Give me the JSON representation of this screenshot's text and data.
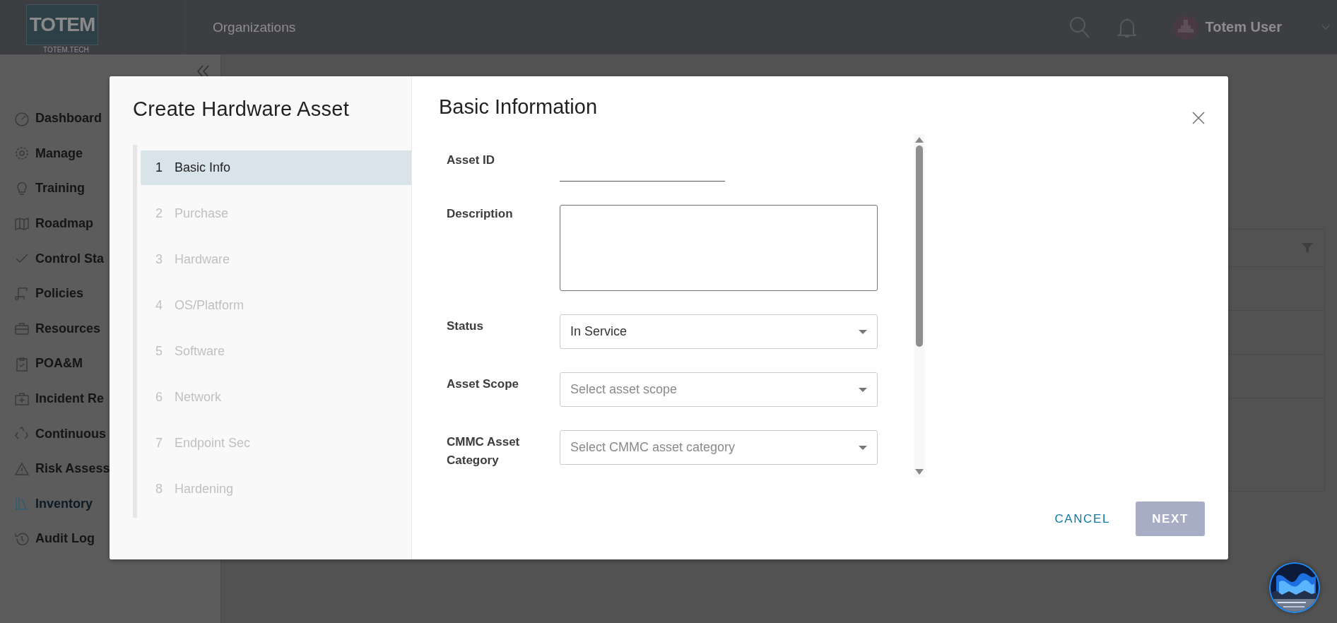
{
  "header": {
    "logo_text": "TOTEM",
    "logo_caption": "TOTEM.TECH",
    "nav_item": "Organizations",
    "user_name": "Totem User"
  },
  "sidebar": {
    "items": [
      {
        "label": "Dashboard",
        "selected": false
      },
      {
        "label": "Manage",
        "selected": false
      },
      {
        "label": "Training",
        "selected": false
      },
      {
        "label": "Roadmap",
        "selected": false
      },
      {
        "label": "Control Sta",
        "selected": false
      },
      {
        "label": "Policies",
        "selected": false
      },
      {
        "label": "Resources",
        "selected": false
      },
      {
        "label": "POA&M",
        "selected": false
      },
      {
        "label": "Incident Re",
        "selected": false
      },
      {
        "label": "Continuous",
        "selected": false
      },
      {
        "label": "Risk Assess",
        "selected": false
      },
      {
        "label": "Inventory",
        "selected": true
      },
      {
        "label": "Audit Log",
        "selected": false
      }
    ]
  },
  "modal": {
    "title": "Create Hardware Asset",
    "steps": [
      {
        "number": "1",
        "label": "Basic Info",
        "selected": true
      },
      {
        "number": "2",
        "label": "Purchase",
        "selected": false
      },
      {
        "number": "3",
        "label": "Hardware",
        "selected": false
      },
      {
        "number": "4",
        "label": "OS/Platform",
        "selected": false
      },
      {
        "number": "5",
        "label": "Software",
        "selected": false
      },
      {
        "number": "6",
        "label": "Network",
        "selected": false
      },
      {
        "number": "7",
        "label": "Endpoint Sec",
        "selected": false
      },
      {
        "number": "8",
        "label": "Hardening",
        "selected": false
      }
    ],
    "section_title": "Basic Information",
    "fields": [
      {
        "kind": "text",
        "label": "Asset ID"
      },
      {
        "kind": "textarea",
        "label": "Description"
      },
      {
        "kind": "select",
        "label": "Status",
        "value": "In Service"
      },
      {
        "kind": "select",
        "label": "Asset Scope",
        "placeholder": "Select asset scope"
      },
      {
        "kind": "select",
        "label": "CMMC Asset Category",
        "placeholder": "Select CMMC asset category"
      }
    ],
    "buttons": {
      "cancel": "CANCEL",
      "next": "NEXT",
      "next_disabled": true
    }
  }
}
